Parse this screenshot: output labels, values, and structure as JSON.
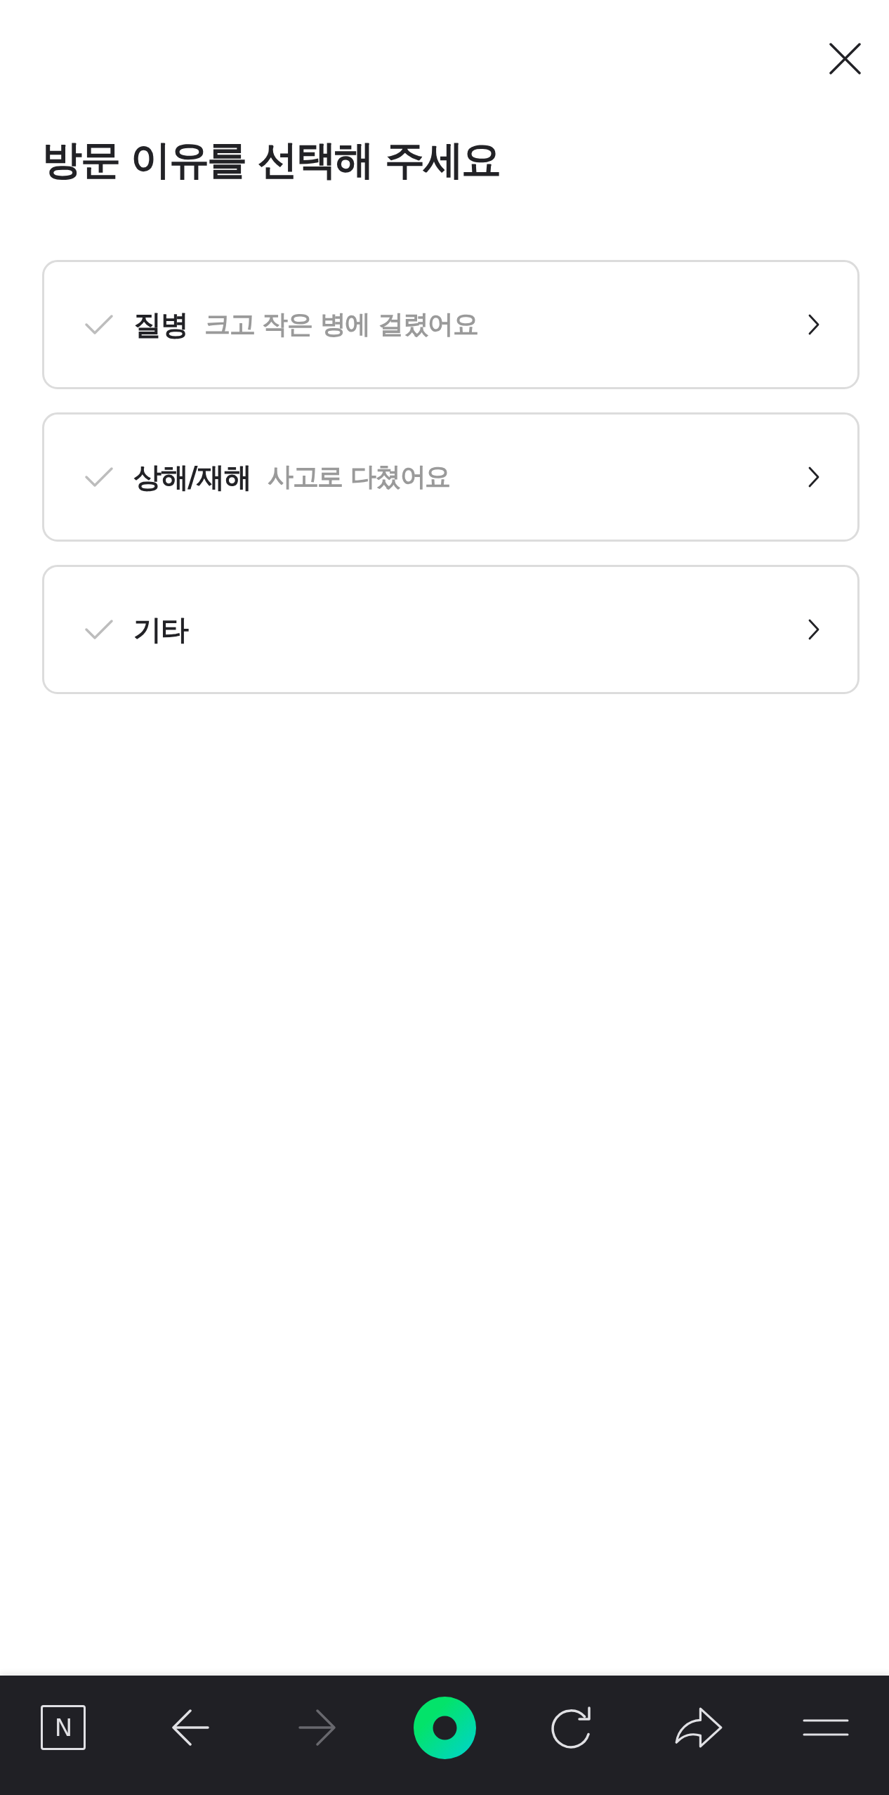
{
  "header": {
    "title": "방문 이유를 선택해 주세요"
  },
  "options": [
    {
      "label": "질병",
      "description": "크고 작은 병에 걸렸어요",
      "selected": false
    },
    {
      "label": "상해/재해",
      "description": "사고로 다쳤어요",
      "selected": false
    },
    {
      "label": "기타",
      "selected": false
    }
  ],
  "bottom_bar": {
    "items": [
      {
        "kind": "logo",
        "label": "N",
        "disabled": false
      },
      {
        "kind": "back",
        "disabled": false
      },
      {
        "kind": "forward",
        "disabled": true
      },
      {
        "kind": "home",
        "disabled": false
      },
      {
        "kind": "reload",
        "disabled": false
      },
      {
        "kind": "share",
        "disabled": false
      },
      {
        "kind": "menu",
        "disabled": false
      }
    ]
  }
}
